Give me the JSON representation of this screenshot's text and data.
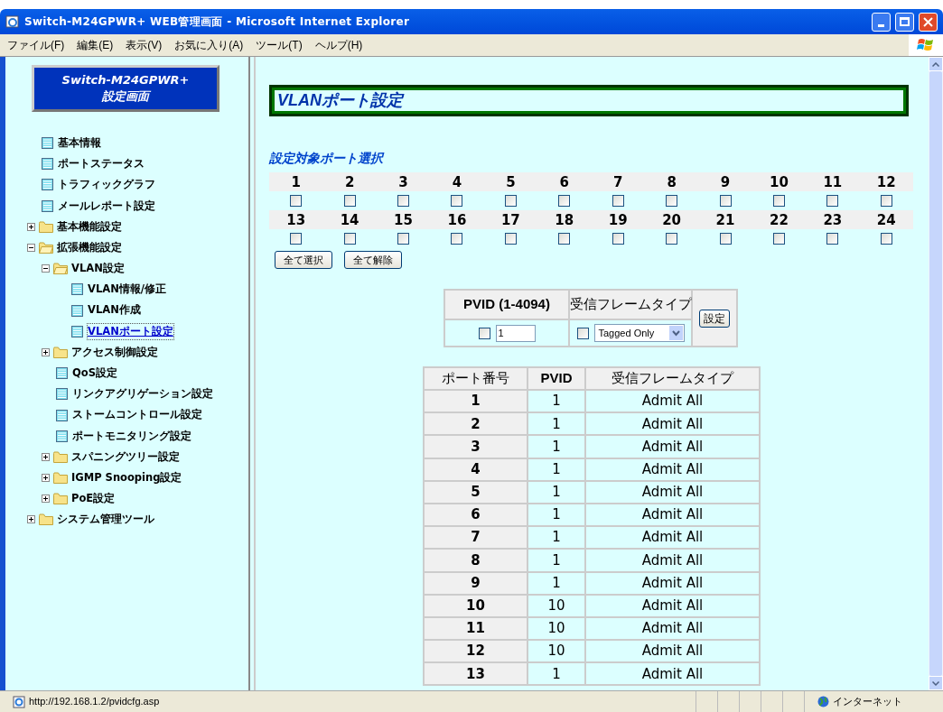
{
  "window": {
    "title": "Switch-M24GPWR+ WEB管理画面 - Microsoft Internet Explorer"
  },
  "menu": [
    "ファイル(F)",
    "編集(E)",
    "表示(V)",
    "お気に入り(A)",
    "ツール(T)",
    "ヘルプ(H)"
  ],
  "sidebar": {
    "logo": [
      "Switch-M24GPWR+",
      "設定画面"
    ],
    "tree": [
      {
        "kind": "page",
        "label": "基本情報",
        "selected": false
      },
      {
        "kind": "page",
        "label": "ポートステータス",
        "selected": false
      },
      {
        "kind": "page",
        "label": "トラフィックグラフ",
        "selected": false
      },
      {
        "kind": "page",
        "label": "メールレポート設定",
        "selected": false
      },
      {
        "kind": "folder",
        "label": "基本機能設定",
        "expanded": false,
        "selected": false
      },
      {
        "kind": "folder",
        "label": "拡張機能設定",
        "expanded": true,
        "selected": false,
        "children": [
          {
            "kind": "folder",
            "label": "VLAN設定",
            "expanded": true,
            "selected": false,
            "children": [
              {
                "kind": "page",
                "label": "VLAN情報/修正",
                "selected": false
              },
              {
                "kind": "page",
                "label": "VLAN作成",
                "selected": false
              },
              {
                "kind": "page",
                "label": "VLANポート設定",
                "selected": true
              }
            ]
          },
          {
            "kind": "folder",
            "label": "アクセス制御設定",
            "expanded": false,
            "selected": false
          },
          {
            "kind": "page",
            "label": "QoS設定",
            "selected": false
          },
          {
            "kind": "page",
            "label": "リンクアグリゲーション設定",
            "selected": false
          },
          {
            "kind": "page",
            "label": "ストームコントロール設定",
            "selected": false
          },
          {
            "kind": "page",
            "label": "ポートモニタリング設定",
            "selected": false
          },
          {
            "kind": "folder",
            "label": "スパニングツリー設定",
            "expanded": false,
            "selected": false
          },
          {
            "kind": "folder",
            "label": "IGMP Snooping設定",
            "expanded": false,
            "selected": false
          },
          {
            "kind": "folder",
            "label": "PoE設定",
            "expanded": false,
            "selected": false
          }
        ]
      },
      {
        "kind": "folder",
        "label": "システム管理ツール",
        "expanded": false,
        "selected": false
      }
    ]
  },
  "main": {
    "heading": "VLANポート設定",
    "section_title": "設定対象ポート選択",
    "ports": [
      {
        "label": "1",
        "checked": false
      },
      {
        "label": "2",
        "checked": false
      },
      {
        "label": "3",
        "checked": false
      },
      {
        "label": "4",
        "checked": false
      },
      {
        "label": "5",
        "checked": false
      },
      {
        "label": "6",
        "checked": false
      },
      {
        "label": "7",
        "checked": false
      },
      {
        "label": "8",
        "checked": false
      },
      {
        "label": "9",
        "checked": false
      },
      {
        "label": "10",
        "checked": false
      },
      {
        "label": "11",
        "checked": false
      },
      {
        "label": "12",
        "checked": false
      },
      {
        "label": "13",
        "checked": false
      },
      {
        "label": "14",
        "checked": false
      },
      {
        "label": "15",
        "checked": false
      },
      {
        "label": "16",
        "checked": false
      },
      {
        "label": "17",
        "checked": false
      },
      {
        "label": "18",
        "checked": false
      },
      {
        "label": "19",
        "checked": false
      },
      {
        "label": "20",
        "checked": false
      },
      {
        "label": "21",
        "checked": false
      },
      {
        "label": "22",
        "checked": false
      },
      {
        "label": "23",
        "checked": false
      },
      {
        "label": "24",
        "checked": false
      }
    ],
    "select_buttons": [
      "全て選択",
      "全て解除"
    ],
    "form": {
      "pvid_header": "PVID (1-4094)",
      "frame_header": "受信フレームタイプ",
      "pvid_checked": false,
      "pvid_value": "1",
      "frame_checked": false,
      "frame_value": "Tagged Only",
      "submit": "設定"
    },
    "table": {
      "columns": [
        "ポート番号",
        "PVID",
        "受信フレームタイプ"
      ],
      "rows": [
        [
          "1",
          "1",
          "Admit All"
        ],
        [
          "2",
          "1",
          "Admit All"
        ],
        [
          "3",
          "1",
          "Admit All"
        ],
        [
          "4",
          "1",
          "Admit All"
        ],
        [
          "5",
          "1",
          "Admit All"
        ],
        [
          "6",
          "1",
          "Admit All"
        ],
        [
          "7",
          "1",
          "Admit All"
        ],
        [
          "8",
          "1",
          "Admit All"
        ],
        [
          "9",
          "1",
          "Admit All"
        ],
        [
          "10",
          "10",
          "Admit All"
        ],
        [
          "11",
          "10",
          "Admit All"
        ],
        [
          "12",
          "10",
          "Admit All"
        ],
        [
          "13",
          "1",
          "Admit All"
        ]
      ]
    }
  },
  "status_bar": {
    "url": "http://192.168.1.2/pvidcfg.asp",
    "zone": "インターネット"
  }
}
